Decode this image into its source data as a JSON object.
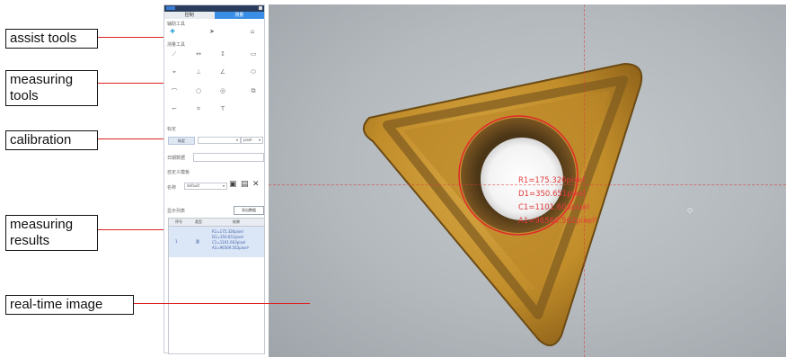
{
  "callouts": {
    "assist": "assist tools",
    "measuring_line1": "measuring",
    "measuring_line2": "tools",
    "calibration": "calibration",
    "results_line1": "measuring",
    "results_line2": "results",
    "realtime": "real-time image"
  },
  "panel": {
    "tabs": [
      "控制",
      "测量"
    ],
    "section_assist": "辅助工具",
    "section_measure": "测量工具",
    "section_calibration": "标定",
    "calibrate_button": "标定",
    "unit_value": "pixel",
    "section_date": "日期数据",
    "section_template": "自定义模板",
    "template_label": "名称",
    "template_value": "default",
    "section_results": "显示列表",
    "export_button": "导出数据",
    "table_headers": [
      "序号",
      "类型",
      "结果"
    ],
    "row": {
      "index": "1",
      "type": "圆",
      "lines": [
        "R1=175.326pixel",
        "D1=350.651pixel",
        "C1=1101.603pixel",
        "A1=96569.562pixel²"
      ]
    }
  },
  "image": {
    "measurements": [
      "R1=175.326pixel",
      "D1=350.651pixel",
      "C1=1101.603pixel",
      "A1=96569.562pixel²"
    ]
  },
  "colors": {
    "leader": "#d22222",
    "measure_text": "#e23b3b",
    "insert_gold": "#c8962a",
    "tab_active": "#3a8ee6"
  }
}
